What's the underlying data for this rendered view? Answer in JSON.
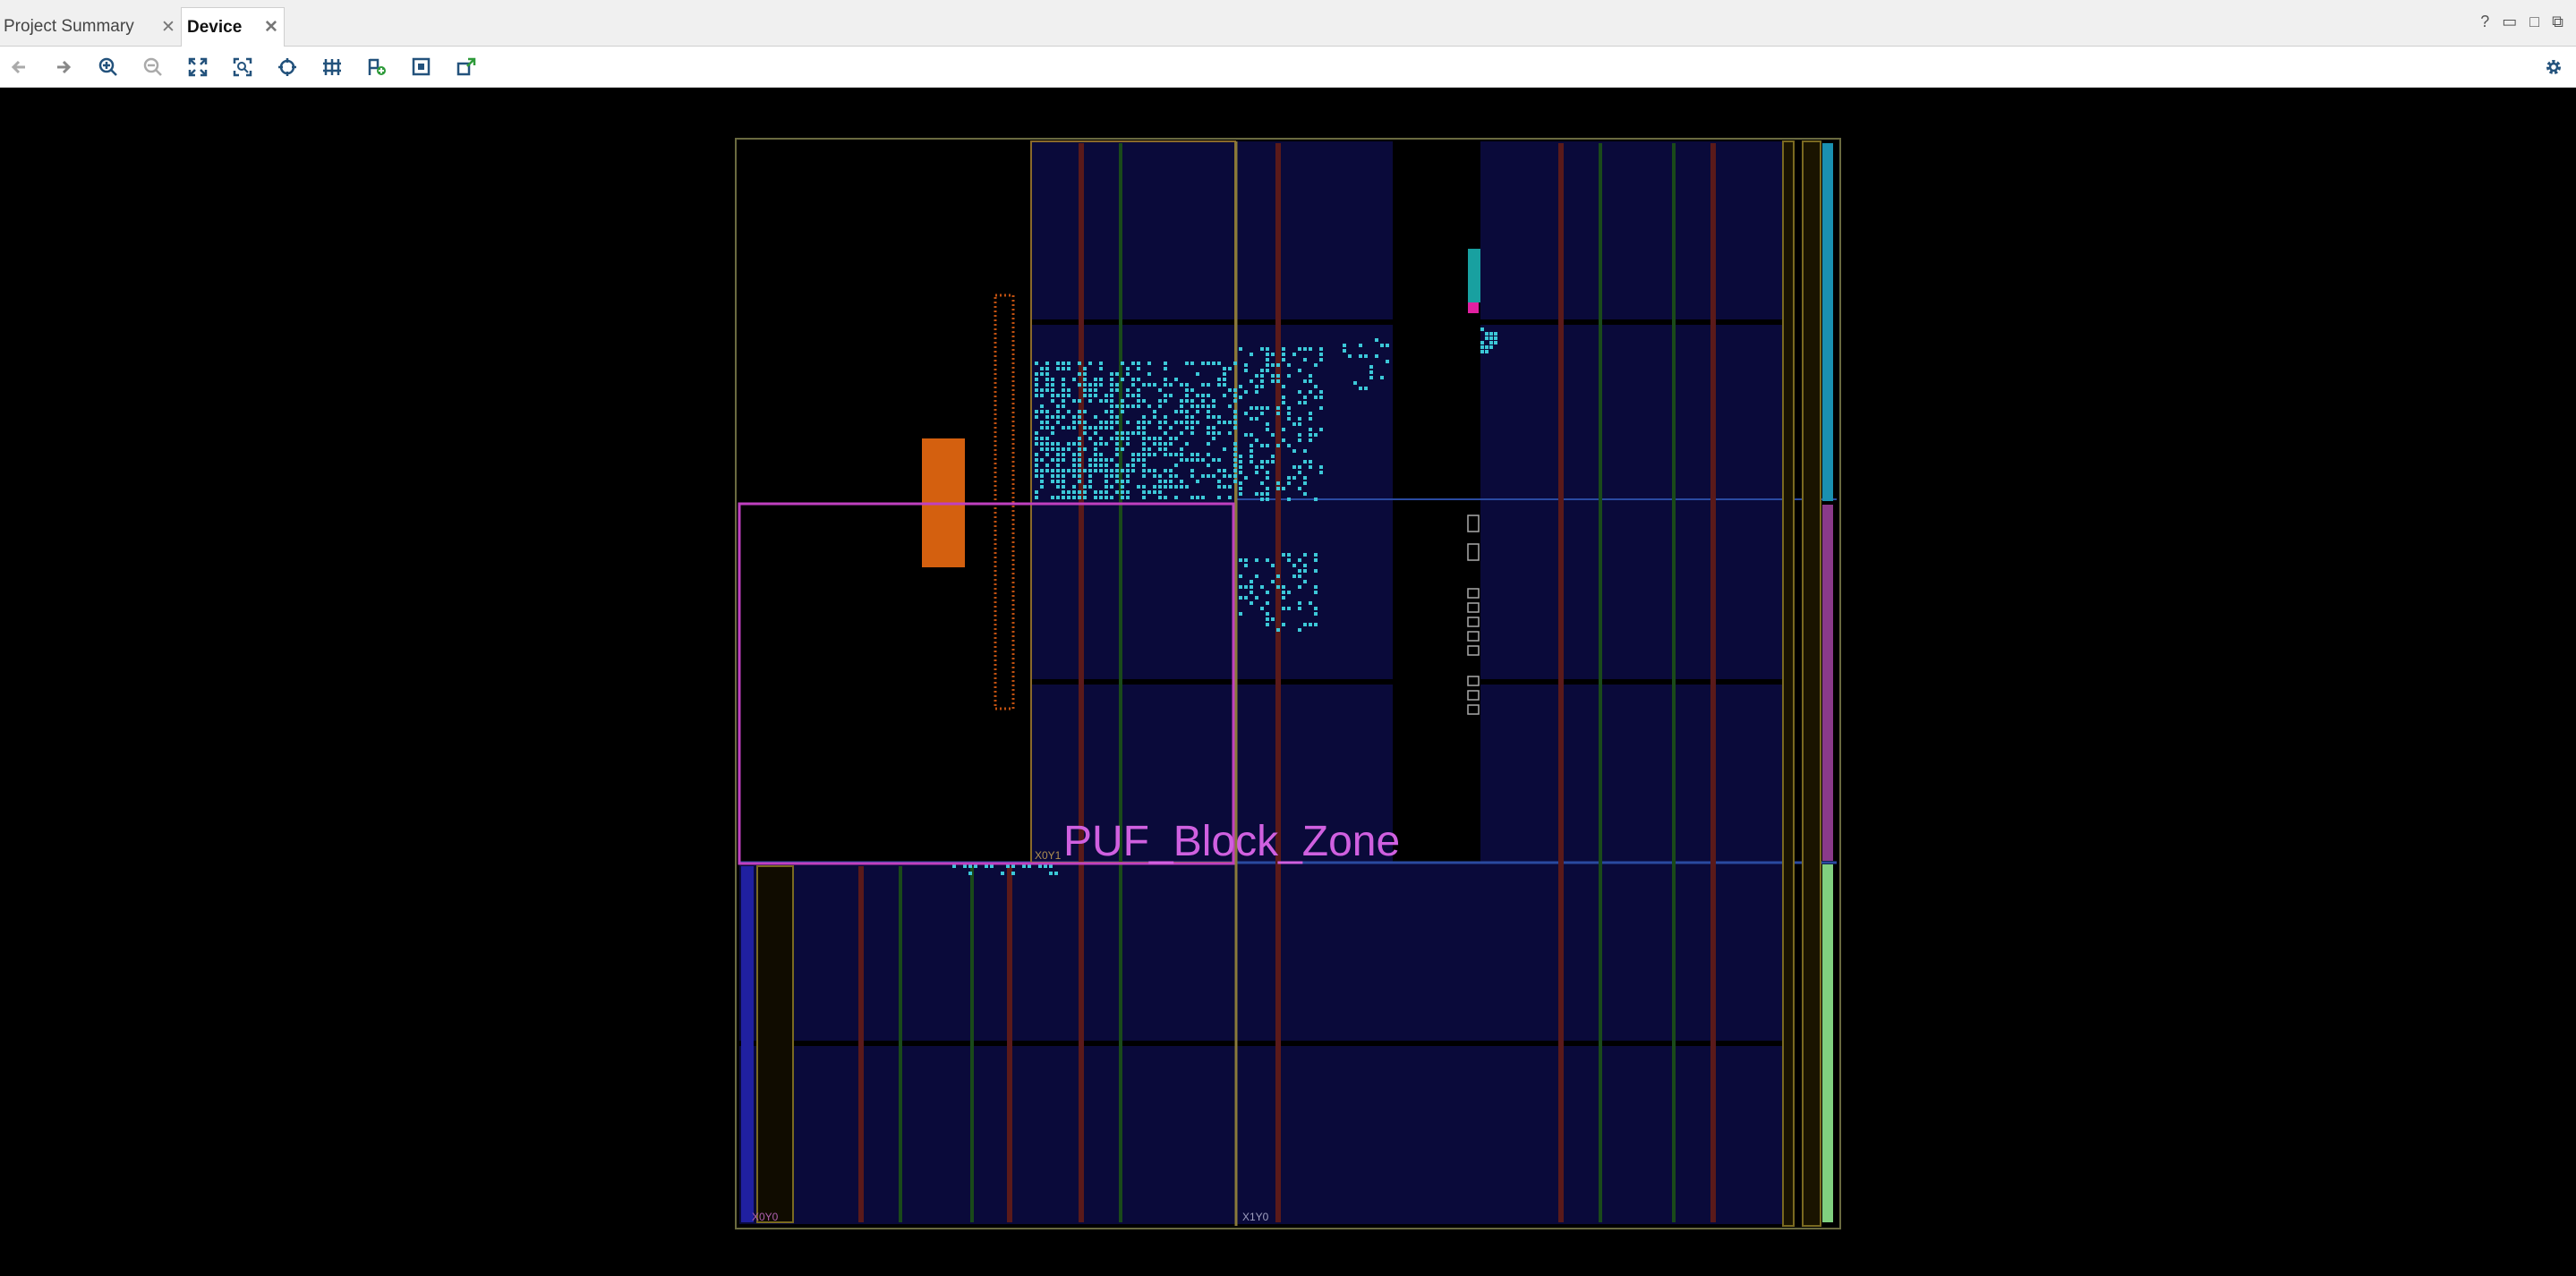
{
  "tabs": [
    {
      "label": "Project Summary",
      "active": false
    },
    {
      "label": "Device",
      "active": true
    }
  ],
  "window_controls": [
    "help-icon",
    "restore-icon",
    "maximize-icon",
    "float-icon"
  ],
  "toolbar": {
    "buttons": [
      "back-icon",
      "forward-icon",
      "zoom-in-icon",
      "zoom-out-icon",
      "zoom-fit-icon",
      "zoom-selection-icon",
      "autofit-selection-icon",
      "routing-resources-icon",
      "add-pblock-icon",
      "draw-pblock-icon",
      "draw-region-icon"
    ],
    "settings": "gear-icon"
  },
  "device": {
    "pblock_label": "PUF_Block_Zone",
    "clock_regions": [
      "X0Y1",
      "X0Y0",
      "X1Y0"
    ],
    "colors": {
      "pblock": "#c040c0",
      "pblock_label": "#d060e0",
      "cells": "#3cc8d8",
      "io": "#e06010",
      "fabric": "#0a0a3a",
      "border": "#7a6a20"
    }
  }
}
